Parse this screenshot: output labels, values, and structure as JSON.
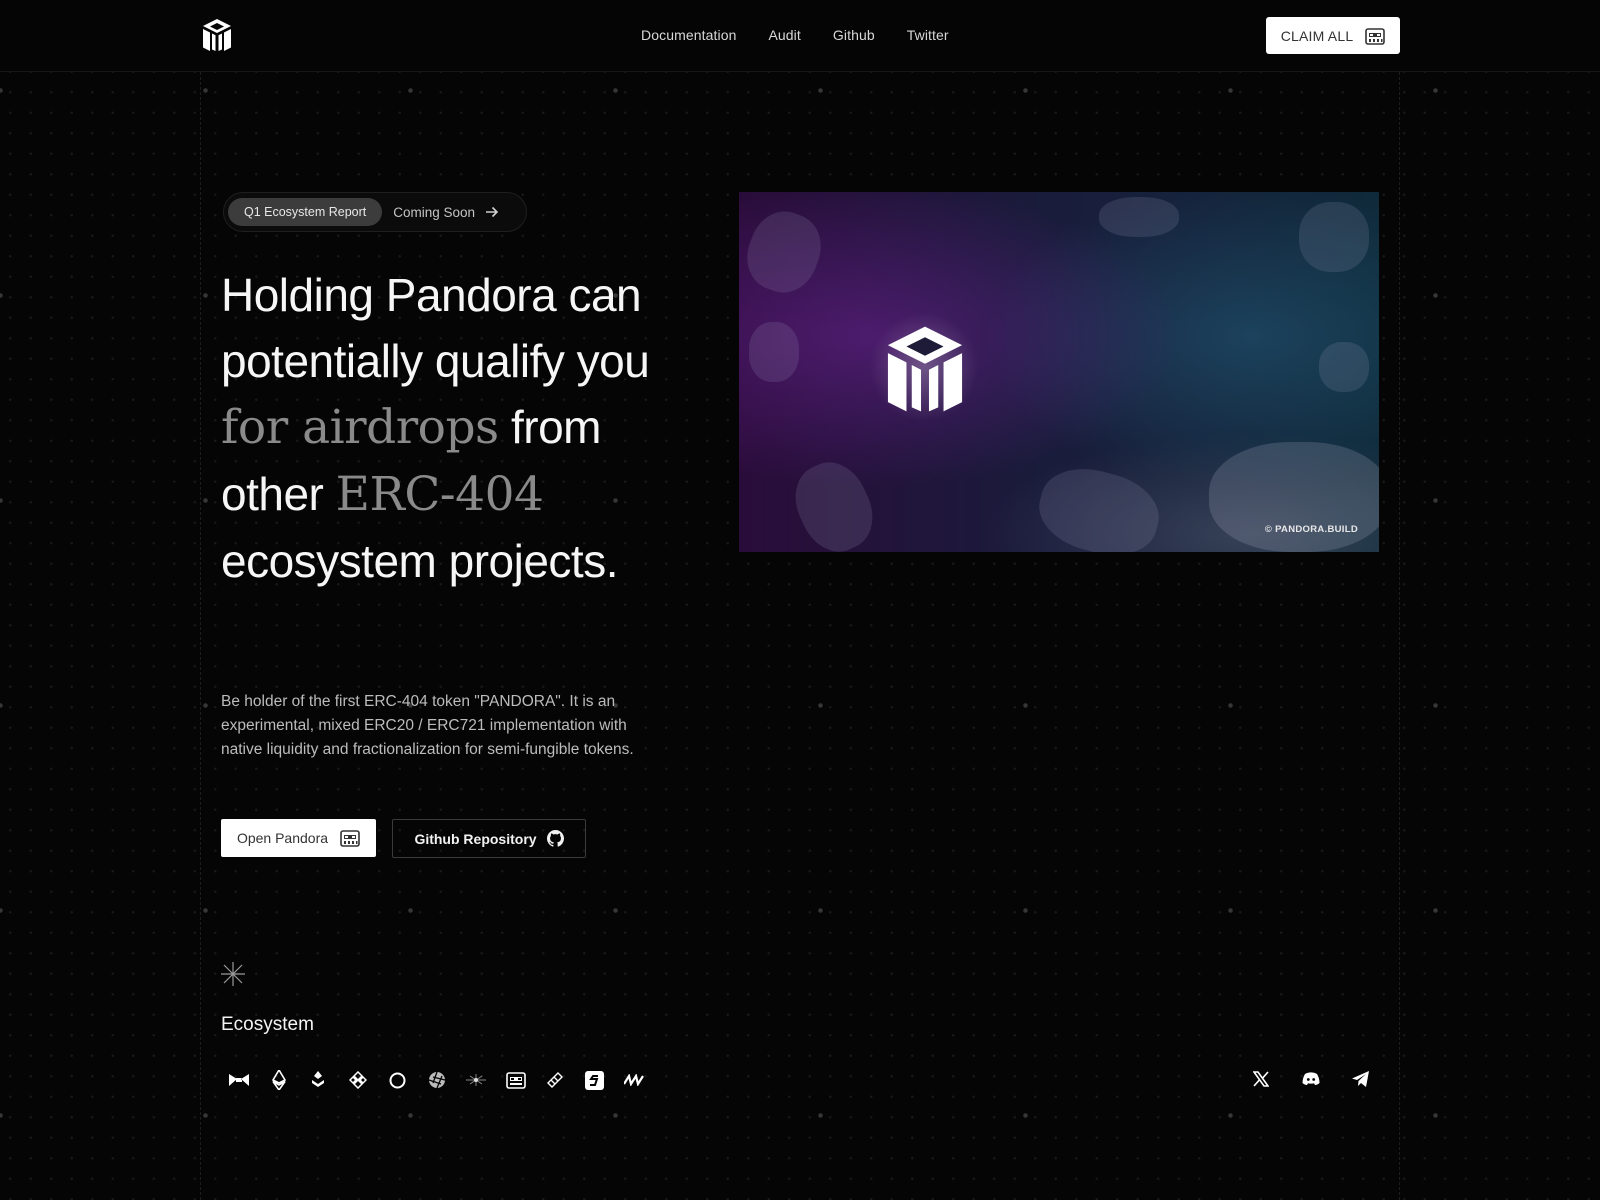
{
  "header": {
    "nav": [
      "Documentation",
      "Audit",
      "Github",
      "Twitter"
    ],
    "claim_label": "CLAIM ALL"
  },
  "badge": {
    "label": "Q1 Ecosystem Report",
    "status": "Coming Soon"
  },
  "hero": {
    "heading_parts": [
      {
        "text": "Holding Pandora can potentially qualify you ",
        "style": "sans"
      },
      {
        "text": "for airdrops",
        "style": "serif"
      },
      {
        "text": " from other ",
        "style": "sans"
      },
      {
        "text": "ERC-404",
        "style": "serif"
      },
      {
        "text": " ecosystem projects.",
        "style": "sans"
      }
    ],
    "description": "Be holder of the first ERC-404 token \"PANDORA\". It is an experimental, mixed ERC20 / ERC721 implementation with native liquidity and fractionalization for semi-fungible tokens.",
    "open_label": "Open Pandora",
    "github_label": "Github Repository",
    "image_credit": "© PANDORA.BUILD"
  },
  "ecosystem": {
    "title": "Ecosystem",
    "icons": [
      "bow-icon",
      "ethereum-icon",
      "layered-chain-icon",
      "binance-icon",
      "circle-icon",
      "aperture-icon",
      "sparkle-icon",
      "robot-icon",
      "pen-stack-icon",
      "s-badge-icon",
      "wave-icon"
    ]
  },
  "social": [
    "x-icon",
    "discord-icon",
    "telegram-icon"
  ]
}
